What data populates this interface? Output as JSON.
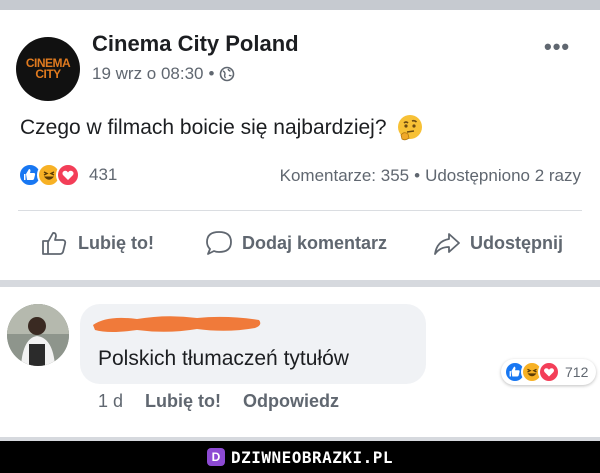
{
  "post": {
    "page_name": "Cinema City Poland",
    "avatar_text_line1": "CINEMA",
    "avatar_text_line2": "CITY",
    "timestamp": "19 wrz o 08:30",
    "separator": "•",
    "more_label": "•••",
    "text": "Czego w filmach boicie się najbardziej?",
    "reaction_count": "431",
    "comments_label": "Komentarze: 355",
    "shares_label": "Udostępniono 2 razy",
    "stats_separator": "•"
  },
  "actions": {
    "like": "Lubię to!",
    "comment": "Dodaj komentarz",
    "share": "Udostępnij"
  },
  "comment": {
    "text": "Polskich tłumaczeń tytułów",
    "reaction_count": "712",
    "age": "1 d",
    "like": "Lubię to!",
    "reply": "Odpowiedz"
  },
  "watermark": {
    "text": "DZIWNEOBRAZKI.PL",
    "icon_letter": "D"
  },
  "colors": {
    "like_blue": "#1877f2",
    "haha_yellow": "#f7b125",
    "love_red": "#f33e58",
    "scribble_orange": "#f07a3a",
    "brand_orange": "#e07a1f"
  },
  "icons": [
    "globe-icon",
    "more-icon",
    "thinking-face-icon",
    "like-reaction-icon",
    "haha-reaction-icon",
    "love-reaction-icon",
    "thumbs-up-icon",
    "comment-bubble-icon",
    "share-arrow-icon"
  ]
}
